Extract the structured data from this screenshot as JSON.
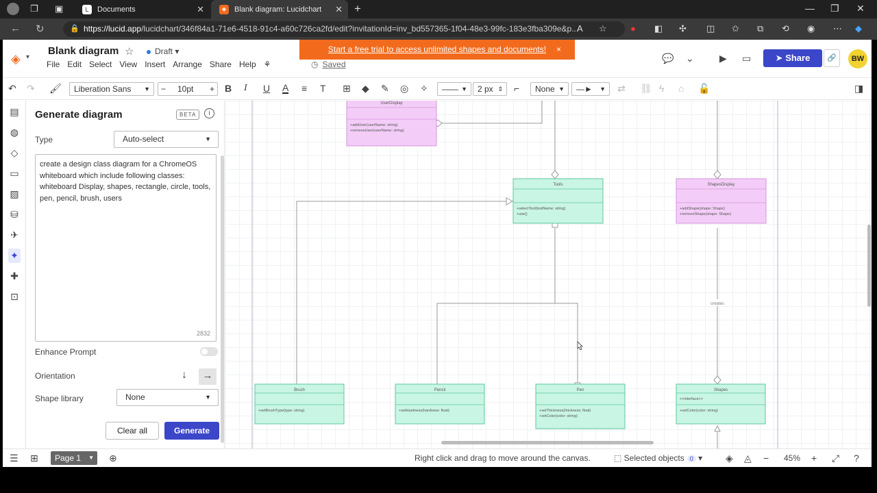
{
  "browser": {
    "tabs": [
      {
        "label": "Documents",
        "icon": "lucid-doc-icon",
        "active": false
      },
      {
        "label": "Blank diagram: Lucidchart",
        "icon": "lucidchart-icon",
        "active": true
      }
    ],
    "url_host": "https://lucid.app",
    "url_path": "/lucidchart/346f84a1-71e6-4518-91c4-a60c726ca2fd/edit?invitationId=inv_bd557365-1f04-48e3-99fc-183e3fba309e&p..."
  },
  "header": {
    "title": "Blank diagram",
    "status": "Draft",
    "menu": [
      "File",
      "Edit",
      "Select",
      "View",
      "Insert",
      "Arrange",
      "Share",
      "Help"
    ],
    "saved": "Saved",
    "banner": "Start a free trial to access unlimited shapes and documents!",
    "banner_close": "×",
    "share_label": "Share",
    "avatar_initials": "BW"
  },
  "toolbar": {
    "font": "Liberation Sans",
    "font_size": "10pt",
    "stroke_width": "2 px",
    "line_end": "None"
  },
  "panel": {
    "title": "Generate diagram",
    "beta": "BETA",
    "type_label": "Type",
    "type_value": "Auto-select",
    "prompt": "create a design class diagram for a ChromeOS whiteboard which include following classes: whiteboard Display, shapes, rectangle, circle, tools, pen, pencil, brush, users",
    "char_count": "2832",
    "enhance_label": "Enhance Prompt",
    "orientation_label": "Orientation",
    "shape_library_label": "Shape library",
    "shape_library_value": "None",
    "clear_label": "Clear all",
    "generate_label": "Generate"
  },
  "diagram": {
    "classes": {
      "userdisplay": {
        "name": "UserDisplay",
        "methods": [
          "+addUser(userName: string)",
          "+removeUser(userName: string)"
        ]
      },
      "tools": {
        "name": "Tools",
        "methods": [
          "+selectTool(toolName: string)",
          "+use()"
        ]
      },
      "shapesdisplay": {
        "name": "ShapesDisplay",
        "methods": [
          "+addShape(shape: Shape)",
          "+removeShape(shape: Shape)"
        ]
      },
      "brush": {
        "name": "Brush",
        "methods": [
          "+setBrushType(type: string)"
        ]
      },
      "pencil": {
        "name": "Pencil",
        "methods": [
          "+setHardness(hardness: float)"
        ]
      },
      "pen": {
        "name": "Pen",
        "methods": [
          "+setThickness(thickness: float)",
          "+setColor(color: string)"
        ]
      },
      "shapes": {
        "name": "Shapes",
        "stereotype": "<<interface>>",
        "methods": [
          "+setColor(color: string)"
        ]
      }
    },
    "edge_label": "creates",
    "colors": {
      "green": "#c9f5e4",
      "green_border": "#5cc79c",
      "pink": "#f3cdf7",
      "pink_border": "#d595dd"
    }
  },
  "bottombar": {
    "page_label": "Page 1",
    "hint": "Right click and drag to move around the canvas.",
    "selected_label": "Selected objects",
    "selected_count": "0",
    "zoom": "45%"
  }
}
